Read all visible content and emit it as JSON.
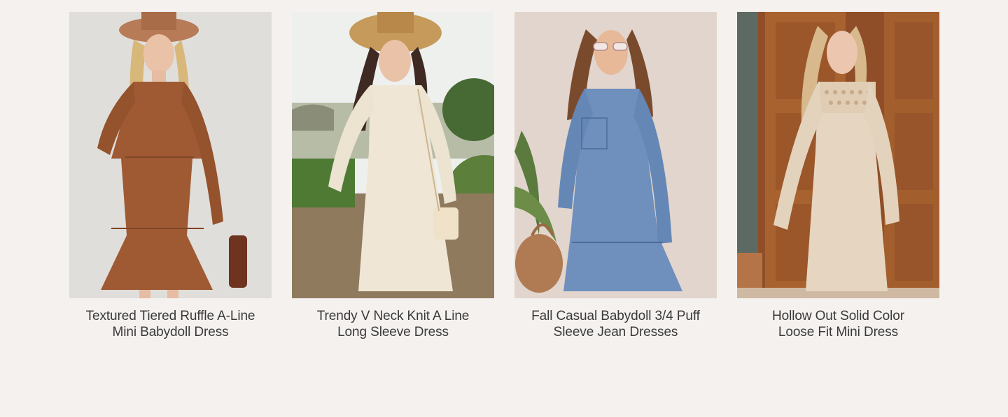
{
  "products": [
    {
      "title_line1": "Textured Tiered Ruffle A-Line",
      "title_line2": "Mini Babydoll Dress",
      "image_name": "brown-tiered-dress-photo"
    },
    {
      "title_line1": "Trendy V Neck Knit A Line",
      "title_line2": "Long Sleeve Dress",
      "image_name": "cream-knit-dress-photo"
    },
    {
      "title_line1": "Fall Casual Babydoll 3/4 Puff",
      "title_line2": "Sleeve Jean Dresses",
      "image_name": "denim-babydoll-dress-photo"
    },
    {
      "title_line1": "Hollow Out Solid Color",
      "title_line2": "Loose Fit Mini Dress",
      "image_name": "beige-lace-dress-photo"
    }
  ],
  "colors": {
    "page_background": "#f5f1ef",
    "title_text": "#3a3a3a"
  }
}
